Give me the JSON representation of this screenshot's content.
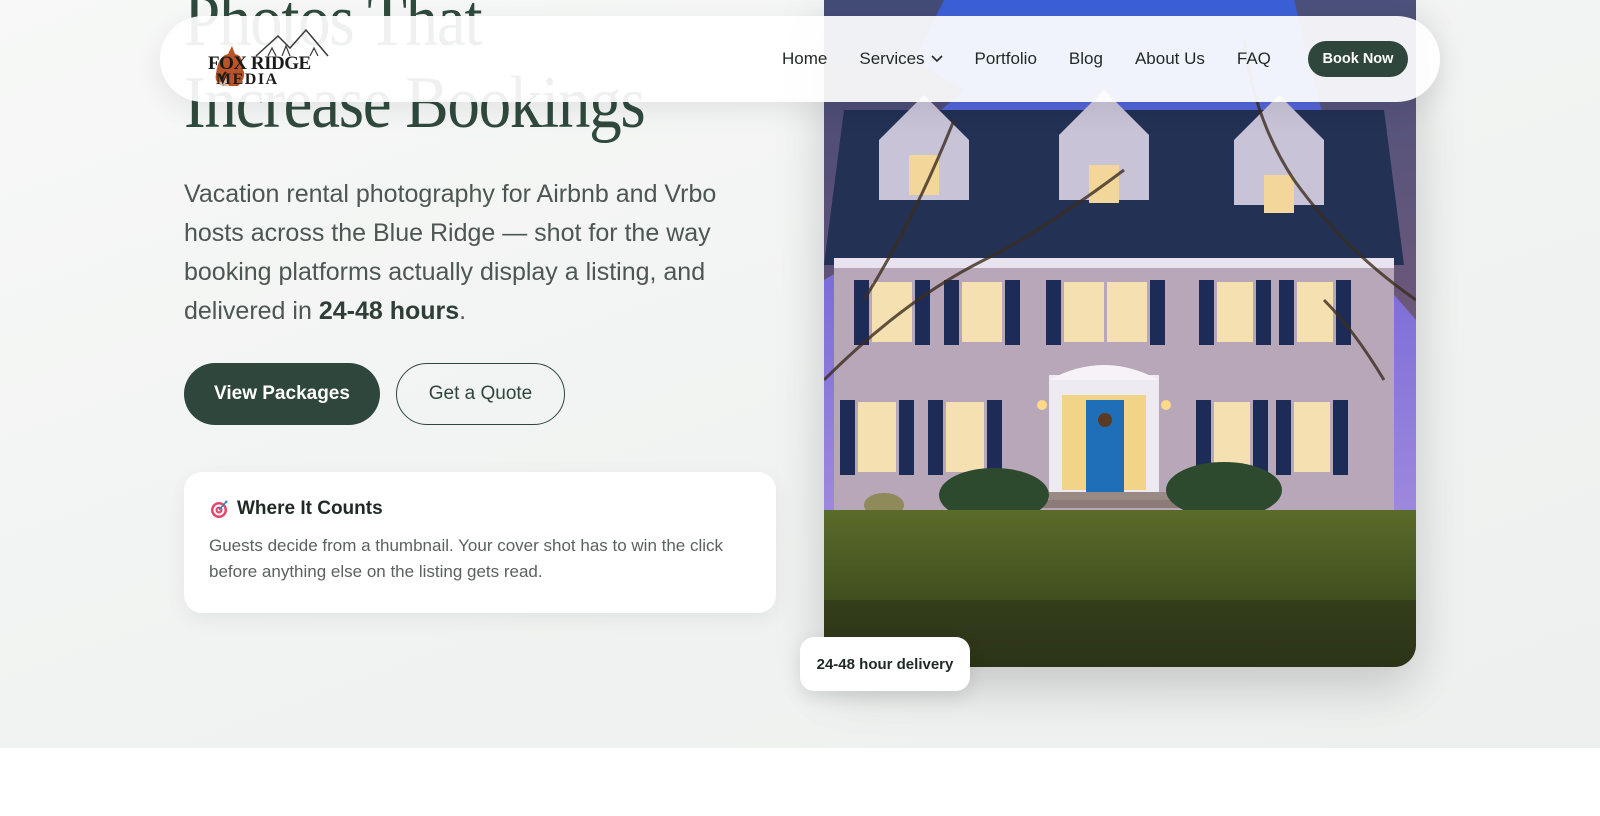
{
  "hero": {
    "headline_line1": "Photos That",
    "headline_line2": "Increase Bookings",
    "lead_text": "Vacation rental photography for Airbnb and Vrbo hosts across the Blue Ridge — shot for the way booking platforms actually display a listing, and delivered in ",
    "lead_bold": "24-48 hours",
    "lead_end": ".",
    "primary_button": "View Packages",
    "secondary_button": "Get a Quote"
  },
  "card": {
    "icon": "target-icon",
    "title": "Where It Counts",
    "text": "Guests decide from a thumbnail. Your cover shot has to win the click before anything else on the listing gets read."
  },
  "badge": {
    "label": "24-48 hour delivery"
  },
  "nav": {
    "logo_line1": "FOX RIDGE",
    "logo_line2": "MEDIA",
    "items": [
      {
        "label": "Home"
      },
      {
        "label": "Services",
        "has_dropdown": true
      },
      {
        "label": "Portfolio"
      },
      {
        "label": "Blog"
      },
      {
        "label": "About Us"
      },
      {
        "label": "FAQ"
      }
    ],
    "cta": "Book Now"
  },
  "colors": {
    "brand_dark_green": "#2f463c",
    "headline_green": "#2f4a3d",
    "door_blue": "#1e6fb8"
  }
}
